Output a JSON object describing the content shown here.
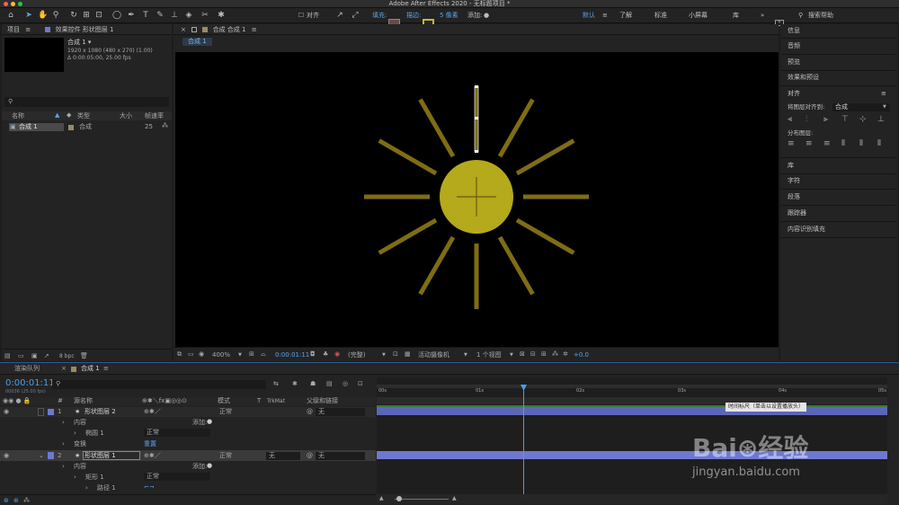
{
  "window": {
    "title": "Adobe After Effects 2020 - 无标题项目 *"
  },
  "toolbar": {
    "align_label": "对齐",
    "fill_label": "填充:",
    "stroke_label": "描边:",
    "stroke_width": "5 像素",
    "add_label": "添加:",
    "workspaces": [
      "默认",
      "了解",
      "标准",
      "小屏幕",
      "库"
    ],
    "search_placeholder": "搜索帮助",
    "colors": {
      "fill": "#6b4a4a",
      "stroke": "#c8b53a",
      "active_workspace": "#5aa3e8"
    }
  },
  "project": {
    "tab": "项目",
    "effects_tab": "效果控件 形状图层 1",
    "item_name": "合成 1 ▾",
    "item_info1": "1920 x 1080 (480 x 270) (1.00)",
    "item_info2": "Δ 0:00:05:00, 25.00 fps",
    "columns": [
      "名称",
      "类型",
      "大小",
      "帧速率"
    ],
    "rows": [
      {
        "name": "合成 1",
        "type": "合成",
        "size": "",
        "fps": "25"
      }
    ],
    "bpc": "8 bpc"
  },
  "composition": {
    "panel_tab": "合成 合成 1",
    "comp_tab": "合成 1",
    "zoom": "400%",
    "timecode": "0:00:01:11",
    "resolution": "(完整)",
    "camera": "活动摄像机",
    "views": "1 个视图",
    "exposure": "+0.0",
    "colors": {
      "sun": "#b5a91c",
      "ray": "#7f6d14"
    }
  },
  "right_panel": {
    "items": [
      "信息",
      "音频",
      "预览",
      "效果和预设"
    ],
    "align": {
      "title": "对齐",
      "align_to_label": "将图层对齐到:",
      "align_to_value": "合成",
      "distribute_label": "分布图层:"
    },
    "more_items": [
      "库",
      "字符",
      "段落",
      "跟踪器",
      "内容识别填充"
    ]
  },
  "timeline": {
    "tabs": [
      "渲染队列",
      "合成 1"
    ],
    "timecode": "0:00:01:11",
    "fps_info": "00036 (25.00 fps)",
    "columns": {
      "source": "源名称",
      "mode": "模式",
      "t": "T",
      "trkmat": "TrkMat",
      "parent": "父级和链接"
    },
    "layers": [
      {
        "num": "1",
        "name": "形状图层 2",
        "mode": "正常",
        "trkmat": "",
        "parent": "无"
      },
      {
        "num": "2",
        "name": "形状图层 1",
        "mode": "正常",
        "trkmat": "无",
        "parent": "无"
      }
    ],
    "sub_rows": [
      {
        "label": "内容",
        "add": "添加:"
      },
      {
        "label": "椭圆 1",
        "mode": "正常"
      },
      {
        "label": "变换",
        "reset": "重置"
      },
      {
        "label": "内容",
        "add": "添加:"
      },
      {
        "label": "矩形 1",
        "mode": "正常"
      },
      {
        "label": "路径 1"
      }
    ],
    "ruler_labels": [
      "00s",
      "01s",
      "02s",
      "03s",
      "04s",
      "05s"
    ],
    "tooltip": "时间标尺（单击以设置播放头）",
    "layer_bar_color": "#6f78cf"
  },
  "watermark": {
    "site": "jingyan.baidu.com"
  }
}
